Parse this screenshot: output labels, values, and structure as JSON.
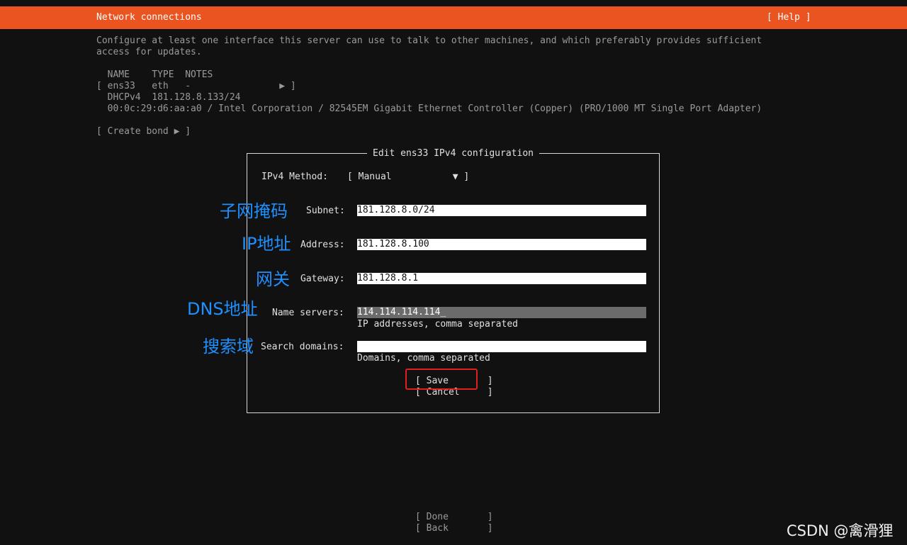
{
  "header": {
    "title": "Network connections",
    "help": "[ Help ]"
  },
  "description": {
    "line1": "Configure at least one interface this server can use to talk to other machines, and which preferably provides sufficient",
    "line2": "access for updates."
  },
  "interfaces": {
    "columns": "  NAME    TYPE  NOTES",
    "row": "[ ens33   eth   -                ▶ ]",
    "dhcp": "  DHCPv4  181.128.8.133/24",
    "hw": "  00:0c:29:d6:aa:a0 / Intel Corporation / 82545EM Gigabit Ethernet Controller (Copper) (PRO/1000 MT Single Port Adapter)",
    "create_bond": "[ Create bond ▶ ]"
  },
  "dialog": {
    "title": "Edit ens33 IPv4 configuration",
    "method_label": "IPv4 Method:",
    "method_value": "[ Manual           ▼ ]",
    "subnet_label": "Subnet:",
    "subnet_value": "181.128.8.0/24",
    "address_label": "Address:",
    "address_value": "181.128.8.100",
    "gateway_label": "Gateway:",
    "gateway_value": "181.128.8.1",
    "ns_label": "Name servers:",
    "ns_value": "114.114.114.114_",
    "ns_hint": "IP addresses, comma separated",
    "sd_label": "Search domains:",
    "sd_value": "",
    "sd_hint": "Domains, comma separated",
    "save": "[ Save       ]",
    "cancel": "[ Cancel     ]"
  },
  "annotations": {
    "subnet": "子网掩码",
    "address": "IP地址",
    "gateway": "网关",
    "dns": "DNS地址",
    "search": "搜索域"
  },
  "footer": {
    "done": "[ Done       ]",
    "back": "[ Back       ]"
  },
  "watermark": "CSDN @禽滑狸",
  "colors": {
    "accent": "#e95420",
    "background": "#111111",
    "annotation": "#1e90ff",
    "highlight": "#e02020"
  }
}
